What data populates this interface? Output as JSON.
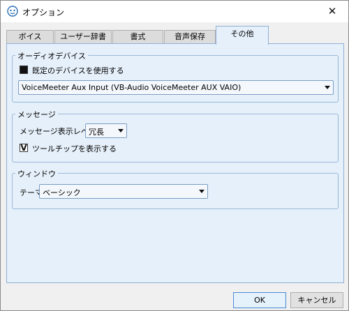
{
  "window": {
    "title": "オプション",
    "close_glyph": "✕"
  },
  "tabs": [
    {
      "label": "ボイス"
    },
    {
      "label": "ユーザー辞書"
    },
    {
      "label": "書式"
    },
    {
      "label": "音声保存"
    },
    {
      "label": "その他",
      "active": true
    }
  ],
  "audio_device": {
    "group_title": "オーディオデバイス",
    "use_default_label": "既定のデバイスを使用する",
    "use_default_checked": false,
    "device_value": "VoiceMeeter Aux Input (VB-Audio VoiceMeeter AUX VAIO)"
  },
  "message": {
    "group_title": "メッセージ",
    "level_label": "メッセージ表示レベル",
    "level_value": "冗長",
    "tooltip_label": "ツールチップを表示する",
    "tooltip_checked": true,
    "check_glyph": "V"
  },
  "window_group": {
    "group_title": "ウィンドウ",
    "theme_label": "テーマ",
    "theme_value": "ベーシック"
  },
  "buttons": {
    "ok": "OK",
    "cancel": "キャンセル"
  },
  "colors": {
    "panel_bg": "#e6f0fa",
    "accent_border": "#4a8ad8"
  },
  "icons": {
    "app": "app-icon",
    "close": "close-icon",
    "dropdown": "chevron-down-icon",
    "checkbox": "checkbox-icon"
  }
}
